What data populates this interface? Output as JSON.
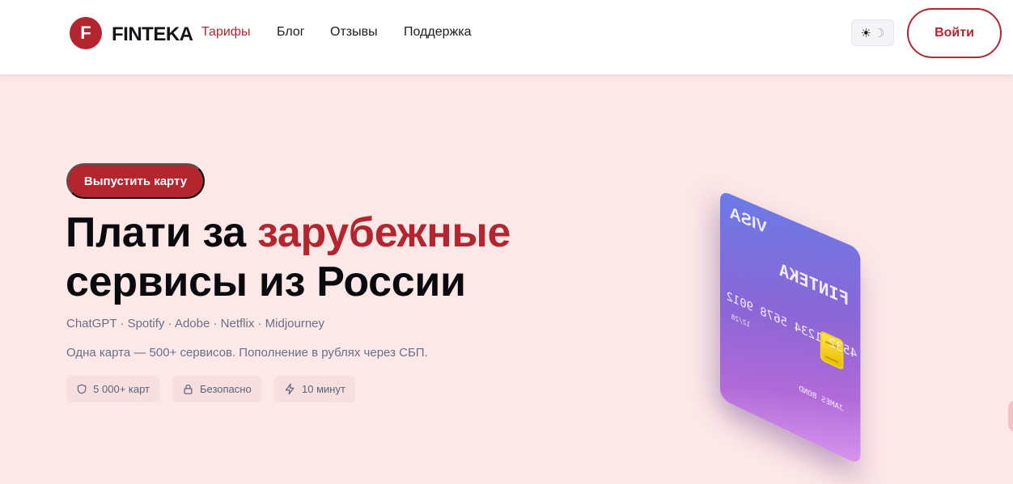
{
  "brand": {
    "logo_letter": "F",
    "name": "FINTEKA",
    "color": "#b3262f"
  },
  "nav": {
    "items": [
      {
        "label": "Тарифы",
        "active": true
      },
      {
        "label": "Блог",
        "active": false
      },
      {
        "label": "Отзывы",
        "active": false
      },
      {
        "label": "Поддержка",
        "active": false
      }
    ]
  },
  "header": {
    "theme_toggle": {
      "sun": "☀",
      "moon": "☽"
    },
    "login_label": "Войти"
  },
  "hero": {
    "cta_label": "Выпустить карту",
    "title_part1": "Плати за ",
    "title_accent": "зарубежные",
    "title_line2": "сервисы из России",
    "services": [
      "ChatGPT",
      "Spotify",
      "Adobe",
      "Netflix",
      "Midjourney"
    ],
    "services_text": "ChatGPT · Spotify · Adobe · Netflix · Midjourney",
    "subtitle": "Одна карта — 500+ сервисов. Пополнение в рублях через СБП.",
    "features": [
      {
        "icon": "shield-icon",
        "label": "5 000+ карт"
      },
      {
        "icon": "lock-icon",
        "label": "Безопасно"
      },
      {
        "icon": "lightning-icon",
        "label": "10 минут"
      }
    ]
  },
  "card": {
    "network": "VISA",
    "brand": "FINTEKA",
    "number": "4532 1234 5678 9012",
    "expiry": "12/28",
    "holder": "JAMES BOND"
  },
  "colors": {
    "accent": "#b3262f",
    "hero_bg": "#fde8e8",
    "muted_text": "#66708a",
    "card_gradient_start": "#6a7be6",
    "card_gradient_end": "#d895ee"
  }
}
